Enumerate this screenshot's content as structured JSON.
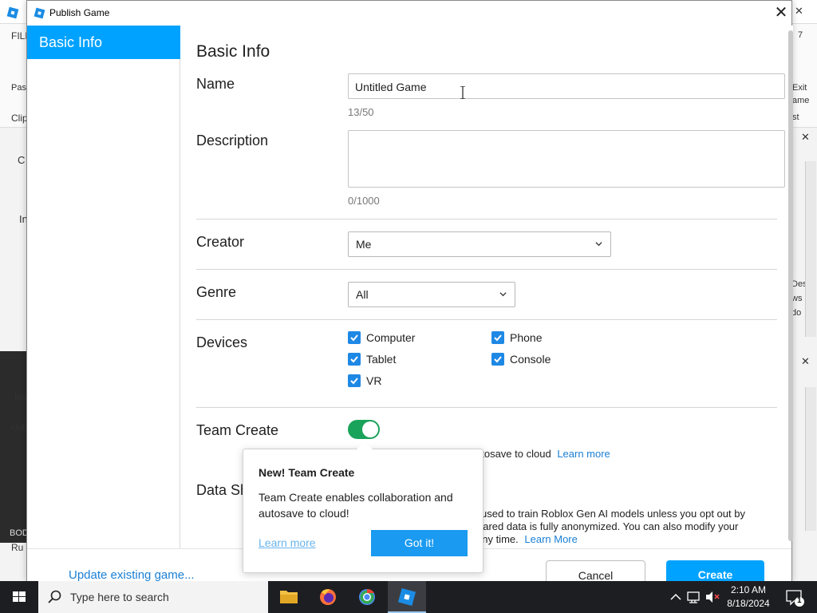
{
  "background": {
    "file_menu": "FILE",
    "paste": "Pas",
    "clipboard": "Clip",
    "exit_game_1": "Exit",
    "exit_game_2": "ame",
    "tab_c": "C",
    "side_i": "In",
    "model_m": "Mo",
    "all": "+All",
    "run": "Ru",
    "right_des": "Des",
    "right_vs": "ws 7",
    "right_do": "do",
    "st": "st",
    "seven": "7",
    "bod": "BOD"
  },
  "dialog": {
    "title": "Publish Game",
    "sidebar": {
      "items": [
        {
          "label": "Basic Info"
        }
      ]
    },
    "heading": "Basic Info",
    "name": {
      "label": "Name",
      "value": "Untitled Game",
      "counter": "13/50"
    },
    "description": {
      "label": "Description",
      "value": "",
      "counter": "0/1000"
    },
    "creator": {
      "label": "Creator",
      "value": "Me"
    },
    "genre": {
      "label": "Genre",
      "value": "All"
    },
    "devices": {
      "label": "Devices",
      "options": [
        {
          "label": "Computer",
          "checked": true
        },
        {
          "label": "Phone",
          "checked": true
        },
        {
          "label": "Tablet",
          "checked": true
        },
        {
          "label": "Console",
          "checked": true
        },
        {
          "label": "VR",
          "checked": true
        }
      ]
    },
    "team_create": {
      "label": "Team Create",
      "enabled": true,
      "desc_tail": "utosave to cloud",
      "learn_more": "Learn more"
    },
    "data_sharing": {
      "label_partial": "Data Sh",
      "line1": "used to train Roblox Gen AI models unless you opt out by",
      "line2": "hared data is fully anonymized. You can also modify your",
      "line3": "any time.",
      "learn_more": "Learn More"
    },
    "footer": {
      "update_link": "Update existing game...",
      "cancel": "Cancel",
      "create": "Create"
    }
  },
  "popup": {
    "title": "New! Team Create",
    "body": "Team Create enables collaboration and autosave to cloud!",
    "learn_more": "Learn more",
    "got_it": "Got it!"
  },
  "taskbar": {
    "search_placeholder": "Type here to search",
    "time": "2:10 AM",
    "date": "8/18/2024",
    "notification_count": "1"
  },
  "colors": {
    "accent": "#00a2ff",
    "toggle_on": "#1aa35a",
    "checkbox": "#1e88e5",
    "link": "#1a7fd4"
  }
}
